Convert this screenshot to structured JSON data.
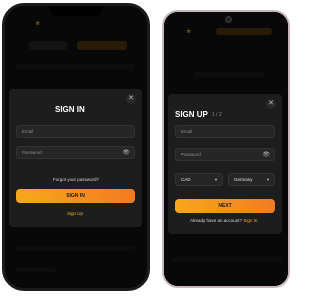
{
  "signin": {
    "title": "SIGN IN",
    "email_placeholder": "Email",
    "password_placeholder": "Password",
    "forgot_password": "Forgot your password?",
    "submit_label": "SIGN IN",
    "signup_link": "Sign Up"
  },
  "signup": {
    "title": "SIGN UP",
    "step": "1 / 2",
    "email_placeholder": "Email",
    "password_placeholder": "Password",
    "currency_value": "CAD",
    "country_value": "Germany",
    "next_label": "NEXT",
    "have_account": "Already have an account?",
    "signin_link": "Sign In"
  },
  "icons": {
    "close": "close-icon",
    "eye": "eye-icon",
    "chevron": "chevron-down-icon"
  },
  "colors": {
    "accent_start": "#f7a81c",
    "accent_end": "#f27b22",
    "link": "#f2b02a",
    "modal_bg": "#1d1d1d",
    "screen_bg": "#121212"
  }
}
